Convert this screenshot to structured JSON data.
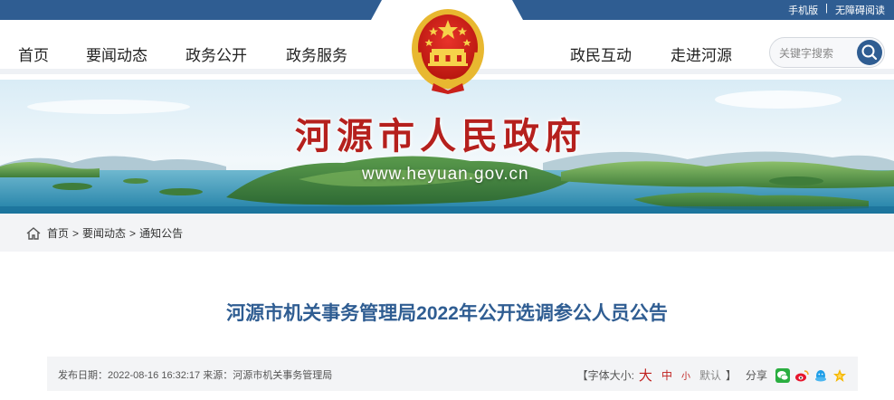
{
  "top_links": {
    "mobile": "手机版",
    "sep": "|",
    "accessible": "无障碍阅读"
  },
  "nav": {
    "left_items": [
      "首页",
      "要闻动态",
      "政务公开",
      "政务服务"
    ],
    "right_items": [
      "政民互动",
      "走进河源"
    ],
    "search_placeholder": "关键字搜索"
  },
  "banner": {
    "title": "河源市人民政府",
    "url": "www.heyuan.gov.cn"
  },
  "breadcrumb": {
    "home": "首页",
    "sep": ">",
    "level1": "要闻动态",
    "level2": "通知公告"
  },
  "article": {
    "title": "河源市机关事务管理局2022年公开选调参公人员公告",
    "meta": "发布日期：2022-08-16 16:32:17 来源：河源市机关事务管理局",
    "font_size_label": "【字体大小:",
    "font_big": "大",
    "font_mid": "中",
    "font_small": "小",
    "font_default": "默认",
    "font_close": "】",
    "share_label": "分享"
  },
  "colors": {
    "brand_blue": "#2f5d92",
    "title_red": "#b5201d",
    "gold": "#e8b830"
  },
  "icons": [
    "home-icon",
    "search-icon",
    "wechat-icon",
    "weibo-icon",
    "qq-icon",
    "qzone-icon",
    "national-emblem"
  ]
}
